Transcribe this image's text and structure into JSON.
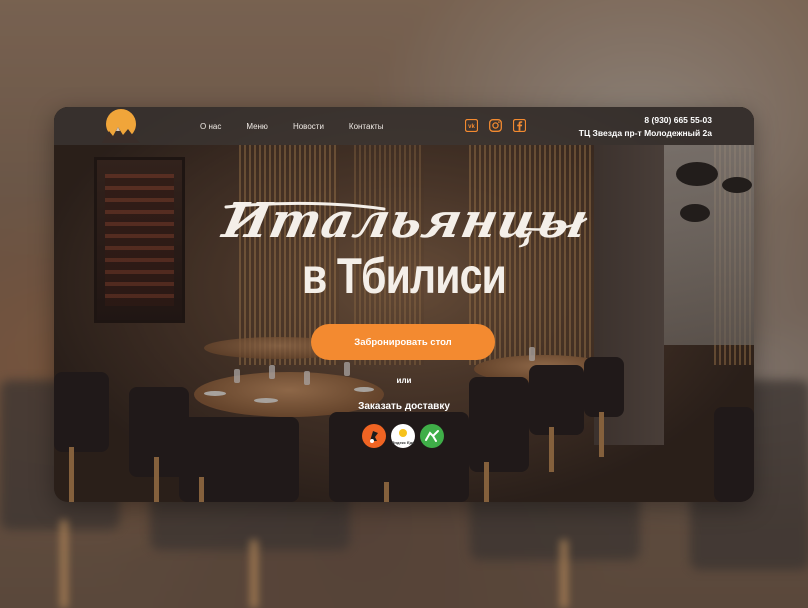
{
  "colors": {
    "accent": "#f38a30",
    "logo_sun": "#f0a53a",
    "delivery_club": "#f06423",
    "yandex_eda_bg": "#ffffff",
    "delivery_green": "#3fae48"
  },
  "header": {
    "nav": [
      "О нас",
      "Меню",
      "Новости",
      "Контакты"
    ],
    "social": [
      "vk-icon",
      "instagram-icon",
      "facebook-icon"
    ],
    "phone": "8 (930) 665 55-03",
    "address": "ТЦ Звезда пр-т Молодежный 2а"
  },
  "hero": {
    "title_script": "Итальянцы",
    "title_sub": "в Тбилиси",
    "book_label": "Забронировать стол",
    "or_label": "или",
    "delivery_label": "Заказать доставку",
    "delivery_services": [
      {
        "icon": "delivery-club-icon",
        "text": ""
      },
      {
        "icon": "yandex-eda-icon",
        "text": "Яндекс Еда"
      },
      {
        "icon": "delivery-courier-icon",
        "text": ""
      }
    ]
  }
}
